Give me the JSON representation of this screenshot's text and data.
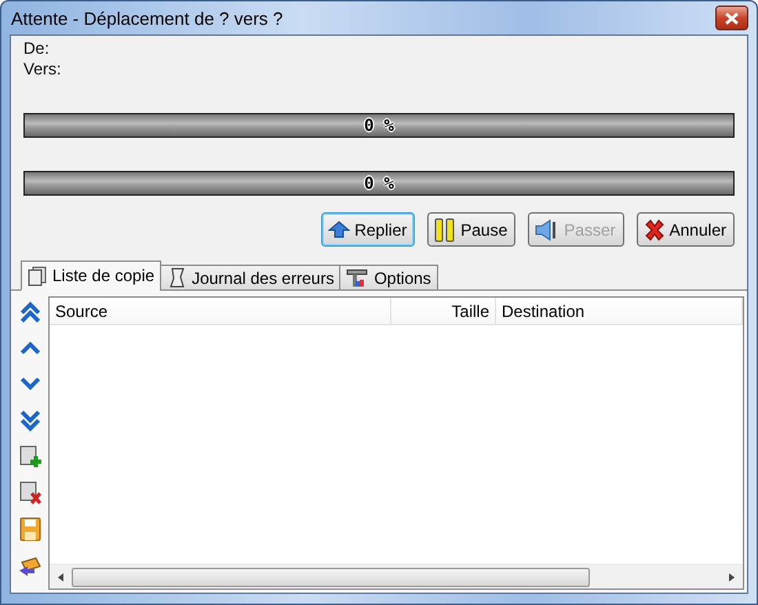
{
  "window": {
    "title": "Attente - Déplacement de ? vers ?"
  },
  "fields": [
    {
      "label": "De:"
    },
    {
      "label": "Vers:"
    }
  ],
  "progress": [
    {
      "level": 0,
      "reading": "0 %"
    },
    {
      "level": 0,
      "reading": "0 %"
    }
  ],
  "buttons": [
    {
      "label": "Replier",
      "kind": "fold",
      "focused": true,
      "disabled": false
    },
    {
      "label": "Pause",
      "kind": "pause",
      "focused": false,
      "disabled": false
    },
    {
      "label": "Passer",
      "kind": "skip",
      "focused": false,
      "disabled": true
    },
    {
      "label": "Annuler",
      "kind": "cancel",
      "focused": false,
      "disabled": false
    }
  ],
  "tabs": [
    {
      "label": "Liste de copie",
      "kind": "list",
      "selected": true
    },
    {
      "label": "Journal des erreurs",
      "kind": "log",
      "selected": false
    },
    {
      "label": "Options",
      "kind": "options",
      "selected": false
    }
  ],
  "table": {
    "columns": [
      {
        "label": "Source",
        "kind": "text"
      },
      {
        "label": "Taille",
        "kind": "number"
      },
      {
        "label": "Destination",
        "kind": "text"
      }
    ]
  }
}
